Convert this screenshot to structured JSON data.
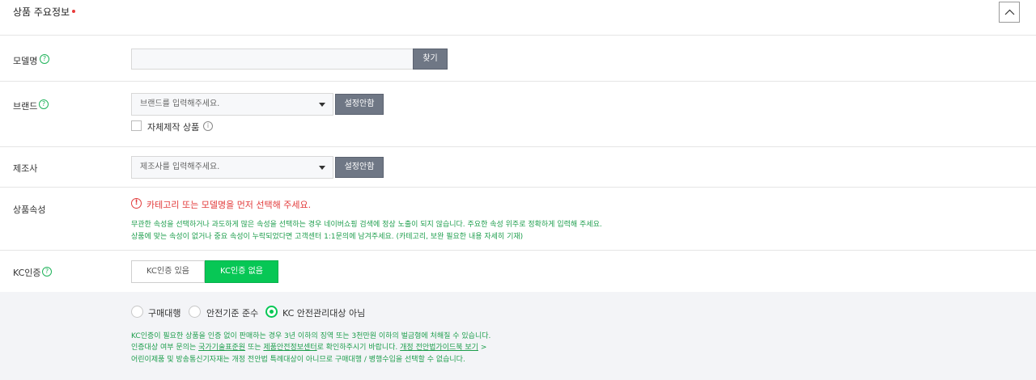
{
  "section": {
    "title": "상품 주요정보",
    "required_mark_color": "#e83b3b",
    "collapse_icon": "chevron-up-icon"
  },
  "model": {
    "label": "모델명",
    "input_value": "",
    "find_button": "찾기"
  },
  "brand": {
    "label": "브랜드",
    "placeholder": "브랜드를 입력해주세요.",
    "set_button": "설정안함",
    "own_product_label": "자체제작 상품"
  },
  "manufacturer": {
    "label": "제조사",
    "placeholder": "제조사를 입력해주세요.",
    "set_button": "설정안함"
  },
  "attributes": {
    "label": "상품속성",
    "warning": "카테고리 또는 모델명을 먼저 선택해 주세요.",
    "guide_line1": "무관한 속성을 선택하거나 과도하게 많은 속성을 선택하는 경우 네이버쇼핑 검색에 정상 노출이 되지 않습니다. 주요한 속성 위주로 정확하게 입력해 주세요.",
    "guide_line2": "상품에 맞는 속성이 없거나 중요 속성이 누락되었다면 고객센터 1:1문의에 남겨주세요. (카테고리, 보완 필요한 내용 자세히 기재)"
  },
  "kc": {
    "label": "KC인증",
    "tabs": [
      "KC인증 있음",
      "KC인증 없음"
    ],
    "active_tab": 1,
    "options": [
      "구매대행",
      "안전기준 준수",
      "KC 안전관리대상 아님"
    ],
    "selected_option": 2,
    "notice_line1": "KC인증이 필요한 상품을 인증 없이 판매하는 경우 3년 이하의 징역 또는 3천만원 이하의 벌금형에 처해질 수 있습니다.",
    "notice_line2_a": "인증대상 여부 문의는 ",
    "notice_link1": "국가기술표준원",
    "notice_line2_b": " 또는 ",
    "notice_link2": "제품안전정보센터",
    "notice_line2_c": "로 확인하주시기 바랍니다. ",
    "notice_link3": "개정 전안법가이드북 보기",
    "notice_line2_d": " >",
    "notice_line3": "어린이제품 및 방송통신기자재는 개정 전안법 특례대상이 아니므로 구매대행 / 병행수입을 선택할 수 없습니다."
  },
  "colors": {
    "accent_green": "#07c755",
    "guide_green": "#1e9e4d",
    "warning_red": "#e23b3b",
    "dark_button": "#6f7785"
  }
}
